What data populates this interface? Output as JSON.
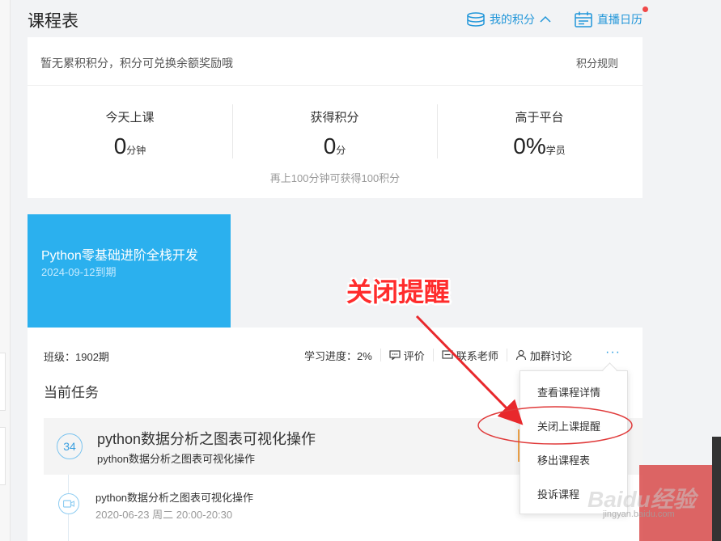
{
  "header": {
    "title": "课程表",
    "my_points_label": "我的积分",
    "live_calendar_label": "直播日历"
  },
  "points_card": {
    "tip": "暂无累积积分，积分可兑换余额奖励哦",
    "rules_label": "积分规则",
    "stats": [
      {
        "label": "今天上课",
        "value": "0",
        "unit": "分钟"
      },
      {
        "label": "获得积分",
        "value": "0",
        "unit": "分"
      },
      {
        "label": "高于平台",
        "value": "0%",
        "unit": "学员"
      }
    ],
    "hint": "再上100分钟可获得100积分"
  },
  "course": {
    "name": "Python零基础进阶全栈开发",
    "expiry": "2024-09-12到期"
  },
  "class_bar": {
    "class_info": "班级：1902期",
    "progress": "学习进度：2%",
    "review": "评价",
    "contact_teacher": "联系老师",
    "join_group": "加群讨论",
    "more": "···"
  },
  "current_task": {
    "heading": "当前任务",
    "number": "34",
    "title": "python数据分析之图表可视化操作",
    "subtitle": "python数据分析之图表可视化操作",
    "lesson_name": "python数据分析之图表可视化操作",
    "lesson_time": "2020-06-23 周二 20:00-20:30"
  },
  "dropdown_menu": {
    "items": [
      "查看课程详情",
      "关闭上课提醒",
      "移出课程表",
      "投诉课程"
    ]
  },
  "annotation": {
    "text": "关闭提醒",
    "color": "#ff2c2c"
  },
  "watermark": {
    "text": "Baidu经验",
    "sub": "jingyan.baidu.com"
  },
  "colors": {
    "accent": "#2bb0ee",
    "link": "#2196d9",
    "annotation_red": "#e8282c"
  }
}
